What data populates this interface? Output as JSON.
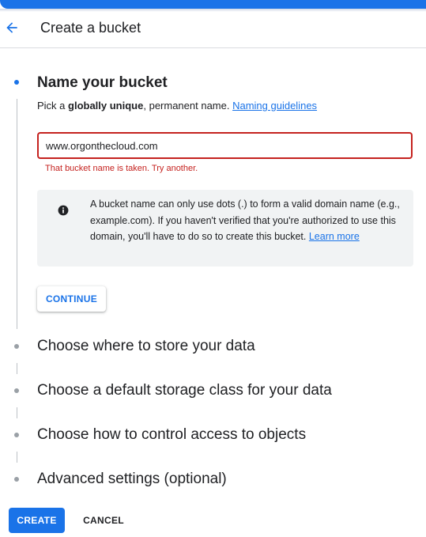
{
  "header": {
    "title": "Create a bucket",
    "back_icon": "arrow-back-icon"
  },
  "colors": {
    "accent": "#1a73e8",
    "error": "#c5221f",
    "info_background": "#f1f3f4"
  },
  "steps": [
    {
      "title": "Name your bucket",
      "active": true,
      "subtitle_prefix": "Pick a ",
      "subtitle_bold": "globally unique",
      "subtitle_suffix": ", permanent name. ",
      "subtitle_link": "Naming guidelines",
      "input_value": "www.orgonthecloud.com",
      "error": "That bucket name is taken. Try another.",
      "info_icon": "info-icon",
      "info_text": "A bucket name can only use dots (.) to form a valid domain name (e.g., example.com). If you haven't verified that you're authorized to use this domain, you'll have to do so to create this bucket. ",
      "info_link": "Learn more",
      "continue_label": "CONTINUE"
    },
    {
      "title": "Choose where to store your data",
      "active": false
    },
    {
      "title": "Choose a default storage class for your data",
      "active": false
    },
    {
      "title": "Choose how to control access to objects",
      "active": false
    },
    {
      "title": "Advanced settings (optional)",
      "active": false
    }
  ],
  "footer": {
    "create_label": "CREATE",
    "cancel_label": "CANCEL"
  }
}
